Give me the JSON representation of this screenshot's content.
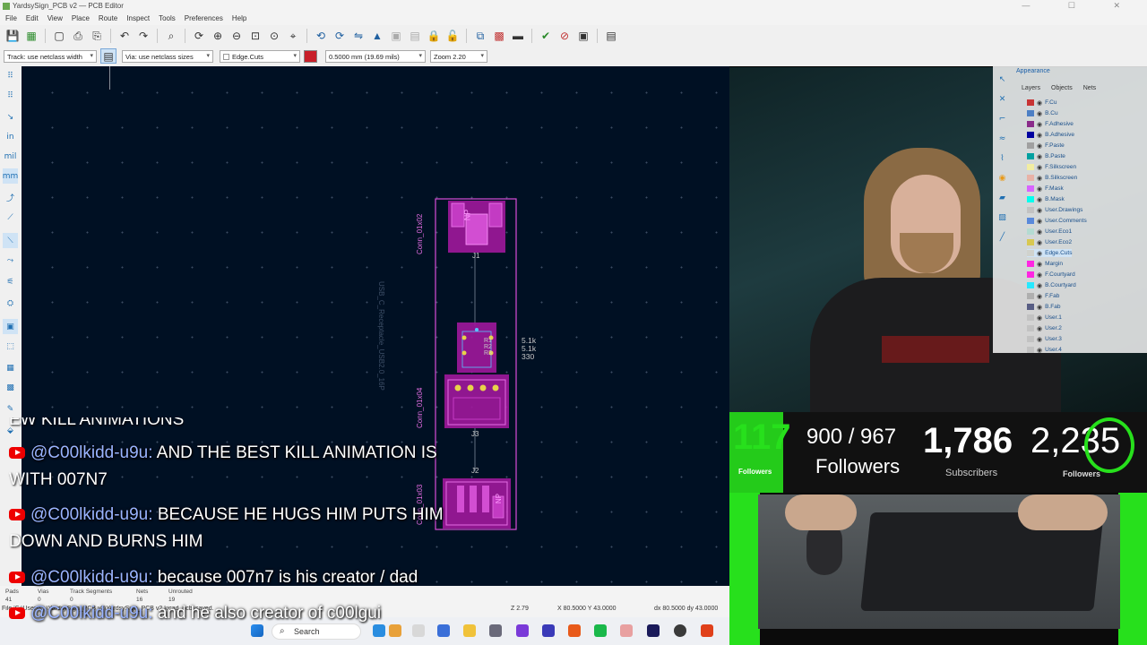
{
  "window": {
    "title": "YardsySign_PCB v2 — PCB Editor",
    "controls": "— ☐ ✕"
  },
  "menu": [
    "File",
    "Edit",
    "View",
    "Place",
    "Route",
    "Inspect",
    "Tools",
    "Preferences",
    "Help"
  ],
  "context_bar": {
    "track": "Track: use netclass width",
    "via": "Via: use netclass sizes",
    "layer": "Edge.Cuts",
    "grid": "0.5000 mm (19.69 mils)",
    "zoom": "Zoom 2.20"
  },
  "board": {
    "conn_top_label": "Conn_01x02",
    "conn_mid_label": "Conn_01x04",
    "conn_bot_label": "Conn_01x03",
    "usb_label": "USB_C_Receptacle_USB2.0_16P",
    "ref_j1": "J1",
    "ref_j2": "J2",
    "ref_j3": "J3",
    "pad_top": "NP",
    "pad_bot": "NP",
    "values": [
      "5.1k",
      "5.1k",
      "330"
    ],
    "res_refs": [
      "R1",
      "R2",
      "R3"
    ]
  },
  "status": {
    "pads_label": "Pads",
    "pads": "41",
    "vias_label": "Vias",
    "vias": "0",
    "segments_label": "Track Segments",
    "segments": "0",
    "nets_label": "Nets",
    "nets": "16",
    "unrouted_label": "Unrouted",
    "unrouted": "19",
    "file": "File 'C:\\Users\\...\\YardsySign_PCB v2\\YardsySign_PCB v2.kicad_pcb' saved.",
    "z": "Z 2.79",
    "xy": "X 80.5000 Y 43.0000",
    "dxdy": "dx 80.5000  dy 43.0000"
  },
  "taskbar": {
    "search": "Search"
  },
  "chat": {
    "partial": "EW KILL ANIMATIONS",
    "messages": [
      {
        "user": "@C00lkidd-u9u:",
        "text": "AND THE BEST KILL ANIMATION IS",
        "cont": "WITH 007N7"
      },
      {
        "user": "@C00lkidd-u9u:",
        "text": "BECAUSE HE HUGS HIM PUTS HIM",
        "cont": "DOWN AND BURNS HIM"
      },
      {
        "user": "@C00lkidd-u9u:",
        "text": "because 007n7 is his creator / dad",
        "cont": ""
      },
      {
        "user": "@C00lkidd-u9u:",
        "text": "and he also creator of c00lgui",
        "cont": ""
      }
    ]
  },
  "appearance": {
    "title": "Appearance",
    "tabs": [
      "Layers",
      "Objects",
      "Nets"
    ],
    "layers": [
      {
        "name": "F.Cu",
        "color": "#c83434"
      },
      {
        "name": "B.Cu",
        "color": "#4d7fc4"
      },
      {
        "name": "F.Adhesive",
        "color": "#8a2b8a"
      },
      {
        "name": "B.Adhesive",
        "color": "#0000a0"
      },
      {
        "name": "F.Paste",
        "color": "#a0a0a0"
      },
      {
        "name": "B.Paste",
        "color": "#00a0a0"
      },
      {
        "name": "F.Silkscreen",
        "color": "#f2eda1"
      },
      {
        "name": "B.Silkscreen",
        "color": "#e8b2a7"
      },
      {
        "name": "F.Mask",
        "color": "#d864ff"
      },
      {
        "name": "B.Mask",
        "color": "#02ffee"
      },
      {
        "name": "User.Drawings",
        "color": "#c2c2c2"
      },
      {
        "name": "User.Comments",
        "color": "#5989db"
      },
      {
        "name": "User.Eco1",
        "color": "#b4dbd2"
      },
      {
        "name": "User.Eco2",
        "color": "#d8c852"
      },
      {
        "name": "Edge.Cuts",
        "color": "#d0d2cd"
      },
      {
        "name": "Margin",
        "color": "#ff26e2"
      },
      {
        "name": "F.Courtyard",
        "color": "#ff26e2"
      },
      {
        "name": "B.Courtyard",
        "color": "#26e9ff"
      },
      {
        "name": "F.Fab",
        "color": "#afafaf"
      },
      {
        "name": "B.Fab",
        "color": "#585d84"
      },
      {
        "name": "User.1",
        "color": "#c2c2c2"
      },
      {
        "name": "User.2",
        "color": "#c2c2c2"
      },
      {
        "name": "User.3",
        "color": "#c2c2c2"
      },
      {
        "name": "User.4",
        "color": "#c2c2c2"
      }
    ]
  },
  "stream_stats": {
    "goal_current": "117",
    "goal_rest": "900 / 967",
    "followers_label": "Followers",
    "subscribers": "1,786",
    "subscribers_label": "Subscribers",
    "followers2": "2,235",
    "followers_small": "Followers"
  }
}
